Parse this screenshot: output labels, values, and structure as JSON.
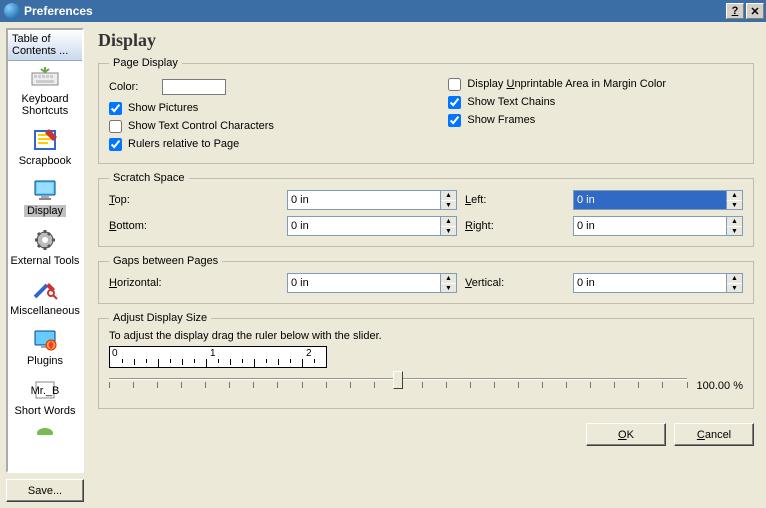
{
  "window": {
    "title": "Preferences"
  },
  "sidebar": {
    "header": "Table of Contents ...",
    "items": [
      {
        "label": "Keyboard Shortcuts"
      },
      {
        "label": "Scrapbook"
      },
      {
        "label": "Display",
        "selected": true
      },
      {
        "label": "External Tools"
      },
      {
        "label": "Miscellaneous"
      },
      {
        "label": "Plugins"
      },
      {
        "label": "Short Words"
      }
    ],
    "save_label": "Save..."
  },
  "page": {
    "title": "Display",
    "page_display": {
      "legend": "Page Display",
      "color_label": "Color:",
      "show_pictures": {
        "label": "Show Pictures",
        "checked": true
      },
      "show_text_ctrl": {
        "label": "Show Text Control Characters",
        "checked": false
      },
      "rulers_relative": {
        "label": "Rulers relative to Page",
        "checked": true
      },
      "unprintable": {
        "label": "Display Unprintable Area in Margin Color",
        "checked": false
      },
      "text_chains": {
        "label": "Show Text Chains",
        "checked": true
      },
      "frames": {
        "label": "Show Frames",
        "checked": true
      }
    },
    "scratch": {
      "legend": "Scratch Space",
      "top_label": "Top:",
      "top_value": "0 in",
      "bottom_label": "Bottom:",
      "bottom_value": "0 in",
      "left_label": "Left:",
      "left_value": "0 in",
      "left_selected": true,
      "right_label": "Right:",
      "right_value": "0 in"
    },
    "gaps": {
      "legend": "Gaps between Pages",
      "horiz_label": "Horizontal:",
      "horiz_value": "0 in",
      "vert_label": "Vertical:",
      "vert_value": "0 in"
    },
    "adjust": {
      "legend": "Adjust Display Size",
      "hint": "To adjust the display drag the ruler below with the slider.",
      "ruler_marks": [
        "0",
        "1",
        "2"
      ],
      "percent": "100.00 %",
      "slider_pos": 0.5
    }
  },
  "buttons": {
    "ok": "OK",
    "cancel": "Cancel"
  }
}
